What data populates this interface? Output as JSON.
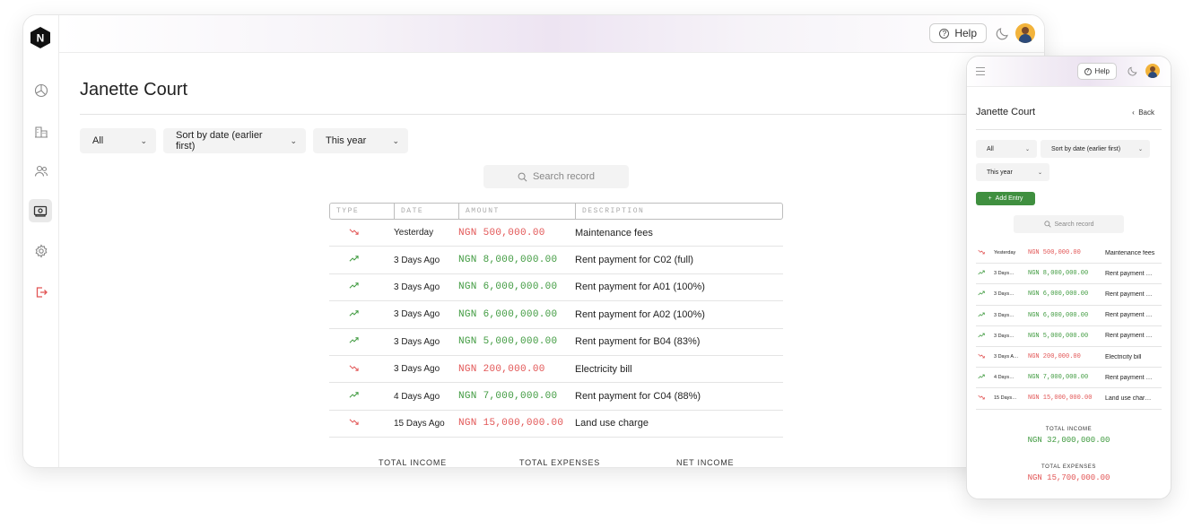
{
  "app": {
    "help_label": "Help",
    "logo_letter": "N"
  },
  "page": {
    "title": "Janette Court",
    "back_label": "Back",
    "add_entry_label": "Add Entry"
  },
  "filters": {
    "type": "All",
    "sort": "Sort by date (earlier first)",
    "period": "This year"
  },
  "search": {
    "placeholder": "Search record"
  },
  "sidebar": {
    "items": [
      {
        "icon": "pie-chart-icon"
      },
      {
        "icon": "building-icon"
      },
      {
        "icon": "users-icon"
      },
      {
        "icon": "cash-icon",
        "active": true
      },
      {
        "icon": "gear-icon"
      },
      {
        "icon": "logout-icon"
      }
    ]
  },
  "table": {
    "headers": [
      "TYPE",
      "DATE",
      "AMOUNT",
      "DESCRIPTION"
    ],
    "rows": [
      {
        "kind": "expense",
        "date": "Yesterday",
        "amount": "NGN 500,000.00",
        "description": "Maintenance fees",
        "mobile_date": "Yesterday",
        "mobile_description": "Maintenance fees"
      },
      {
        "kind": "income",
        "date": "3 Days Ago",
        "amount": "NGN 8,000,000.00",
        "description": "Rent payment for C02 (full)",
        "mobile_date": "3 Days…",
        "mobile_description": "Rent payment …"
      },
      {
        "kind": "income",
        "date": "3 Days Ago",
        "amount": "NGN 6,000,000.00",
        "description": "Rent payment for A01 (100%)",
        "mobile_date": "3 Days…",
        "mobile_description": "Rent payment …"
      },
      {
        "kind": "income",
        "date": "3 Days Ago",
        "amount": "NGN 6,000,000.00",
        "description": "Rent payment for A02 (100%)",
        "mobile_date": "3 Days…",
        "mobile_description": "Rent payment …"
      },
      {
        "kind": "income",
        "date": "3 Days Ago",
        "amount": "NGN 5,000,000.00",
        "description": "Rent payment for B04 (83%)",
        "mobile_date": "3 Days…",
        "mobile_description": "Rent payment …"
      },
      {
        "kind": "expense",
        "date": "3 Days Ago",
        "amount": "NGN 200,000.00",
        "description": "Electricity bill",
        "mobile_date": "3 Days A…",
        "mobile_description": "Electricity bill"
      },
      {
        "kind": "income",
        "date": "4 Days Ago",
        "amount": "NGN 7,000,000.00",
        "description": "Rent payment for C04 (88%)",
        "mobile_date": "4 Days…",
        "mobile_description": "Rent payment …"
      },
      {
        "kind": "expense",
        "date": "15 Days Ago",
        "amount": "NGN 15,000,000.00",
        "description": "Land use charge",
        "mobile_date": "15 Days…",
        "mobile_description": "Land use char…"
      }
    ]
  },
  "totals": {
    "income_label": "TOTAL INCOME",
    "expenses_label": "TOTAL EXPENSES",
    "net_label": "NET INCOME",
    "income_value": "NGN 32,000,000.00",
    "expenses_value": "NGN 15,700,000.00"
  },
  "colors": {
    "income": "#3f9a3f",
    "expense": "#e25555",
    "accent": "#3f8f3f"
  }
}
